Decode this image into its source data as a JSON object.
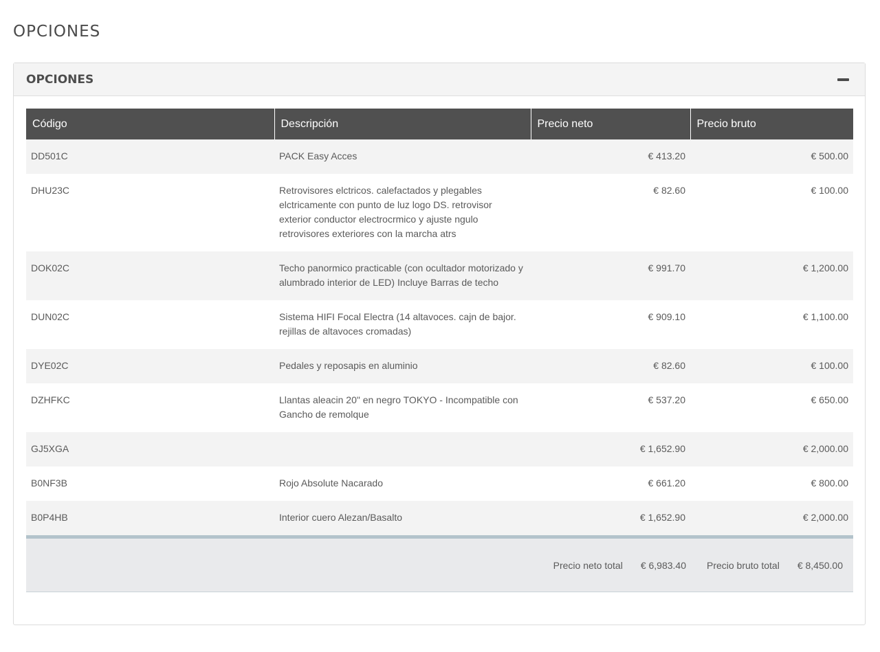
{
  "page": {
    "title": "OPCIONES"
  },
  "panel": {
    "title": "OPCIONES",
    "collapse_icon": "minus-icon"
  },
  "table": {
    "headers": [
      "Código",
      "Descripción",
      "Precio neto",
      "Precio bruto"
    ],
    "rows": [
      {
        "code": "DD501C",
        "description": "PACK Easy Acces",
        "net": "€ 413.20",
        "gross": "€ 500.00"
      },
      {
        "code": "DHU23C",
        "description": "Retrovisores elctricos. calefactados y plegables elctricamente con punto de luz logo DS. retrovisor exterior conductor electrocrmico y ajuste ngulo retrovisores exteriores con la marcha atrs",
        "net": "€ 82.60",
        "gross": "€ 100.00"
      },
      {
        "code": "DOK02C",
        "description": "Techo panormico practicable (con ocultador motorizado y alumbrado interior de LED) Incluye Barras de techo",
        "net": "€ 991.70",
        "gross": "€ 1,200.00"
      },
      {
        "code": "DUN02C",
        "description": "Sistema HIFI Focal Electra (14 altavoces. cajn de bajor. rejillas de altavoces cromadas)",
        "net": "€ 909.10",
        "gross": "€ 1,100.00"
      },
      {
        "code": "DYE02C",
        "description": "Pedales y reposapis en aluminio",
        "net": "€ 82.60",
        "gross": "€ 100.00"
      },
      {
        "code": "DZHFKC",
        "description": "Llantas aleacin 20\" en negro TOKYO - Incompatible con Gancho de remolque",
        "net": "€ 537.20",
        "gross": "€ 650.00"
      },
      {
        "code": "GJ5XGA",
        "description": "",
        "net": "€ 1,652.90",
        "gross": "€ 2,000.00"
      },
      {
        "code": "B0NF3B",
        "description": "Rojo Absolute Nacarado",
        "net": "€ 661.20",
        "gross": "€ 800.00"
      },
      {
        "code": "B0P4HB",
        "description": "Interior cuero Alezan/Basalto",
        "net": "€ 1,652.90",
        "gross": "€ 2,000.00"
      }
    ],
    "totals": {
      "net_label": "Precio neto total",
      "net_value": "€ 6,983.40",
      "gross_label": "Precio bruto total",
      "gross_value": "€ 8,450.00"
    }
  },
  "colors": {
    "header_bg": "#505050",
    "row_alt": "#f3f3f3",
    "footer_bg": "#e9eaec",
    "footer_accent": "#b3c3cb"
  }
}
